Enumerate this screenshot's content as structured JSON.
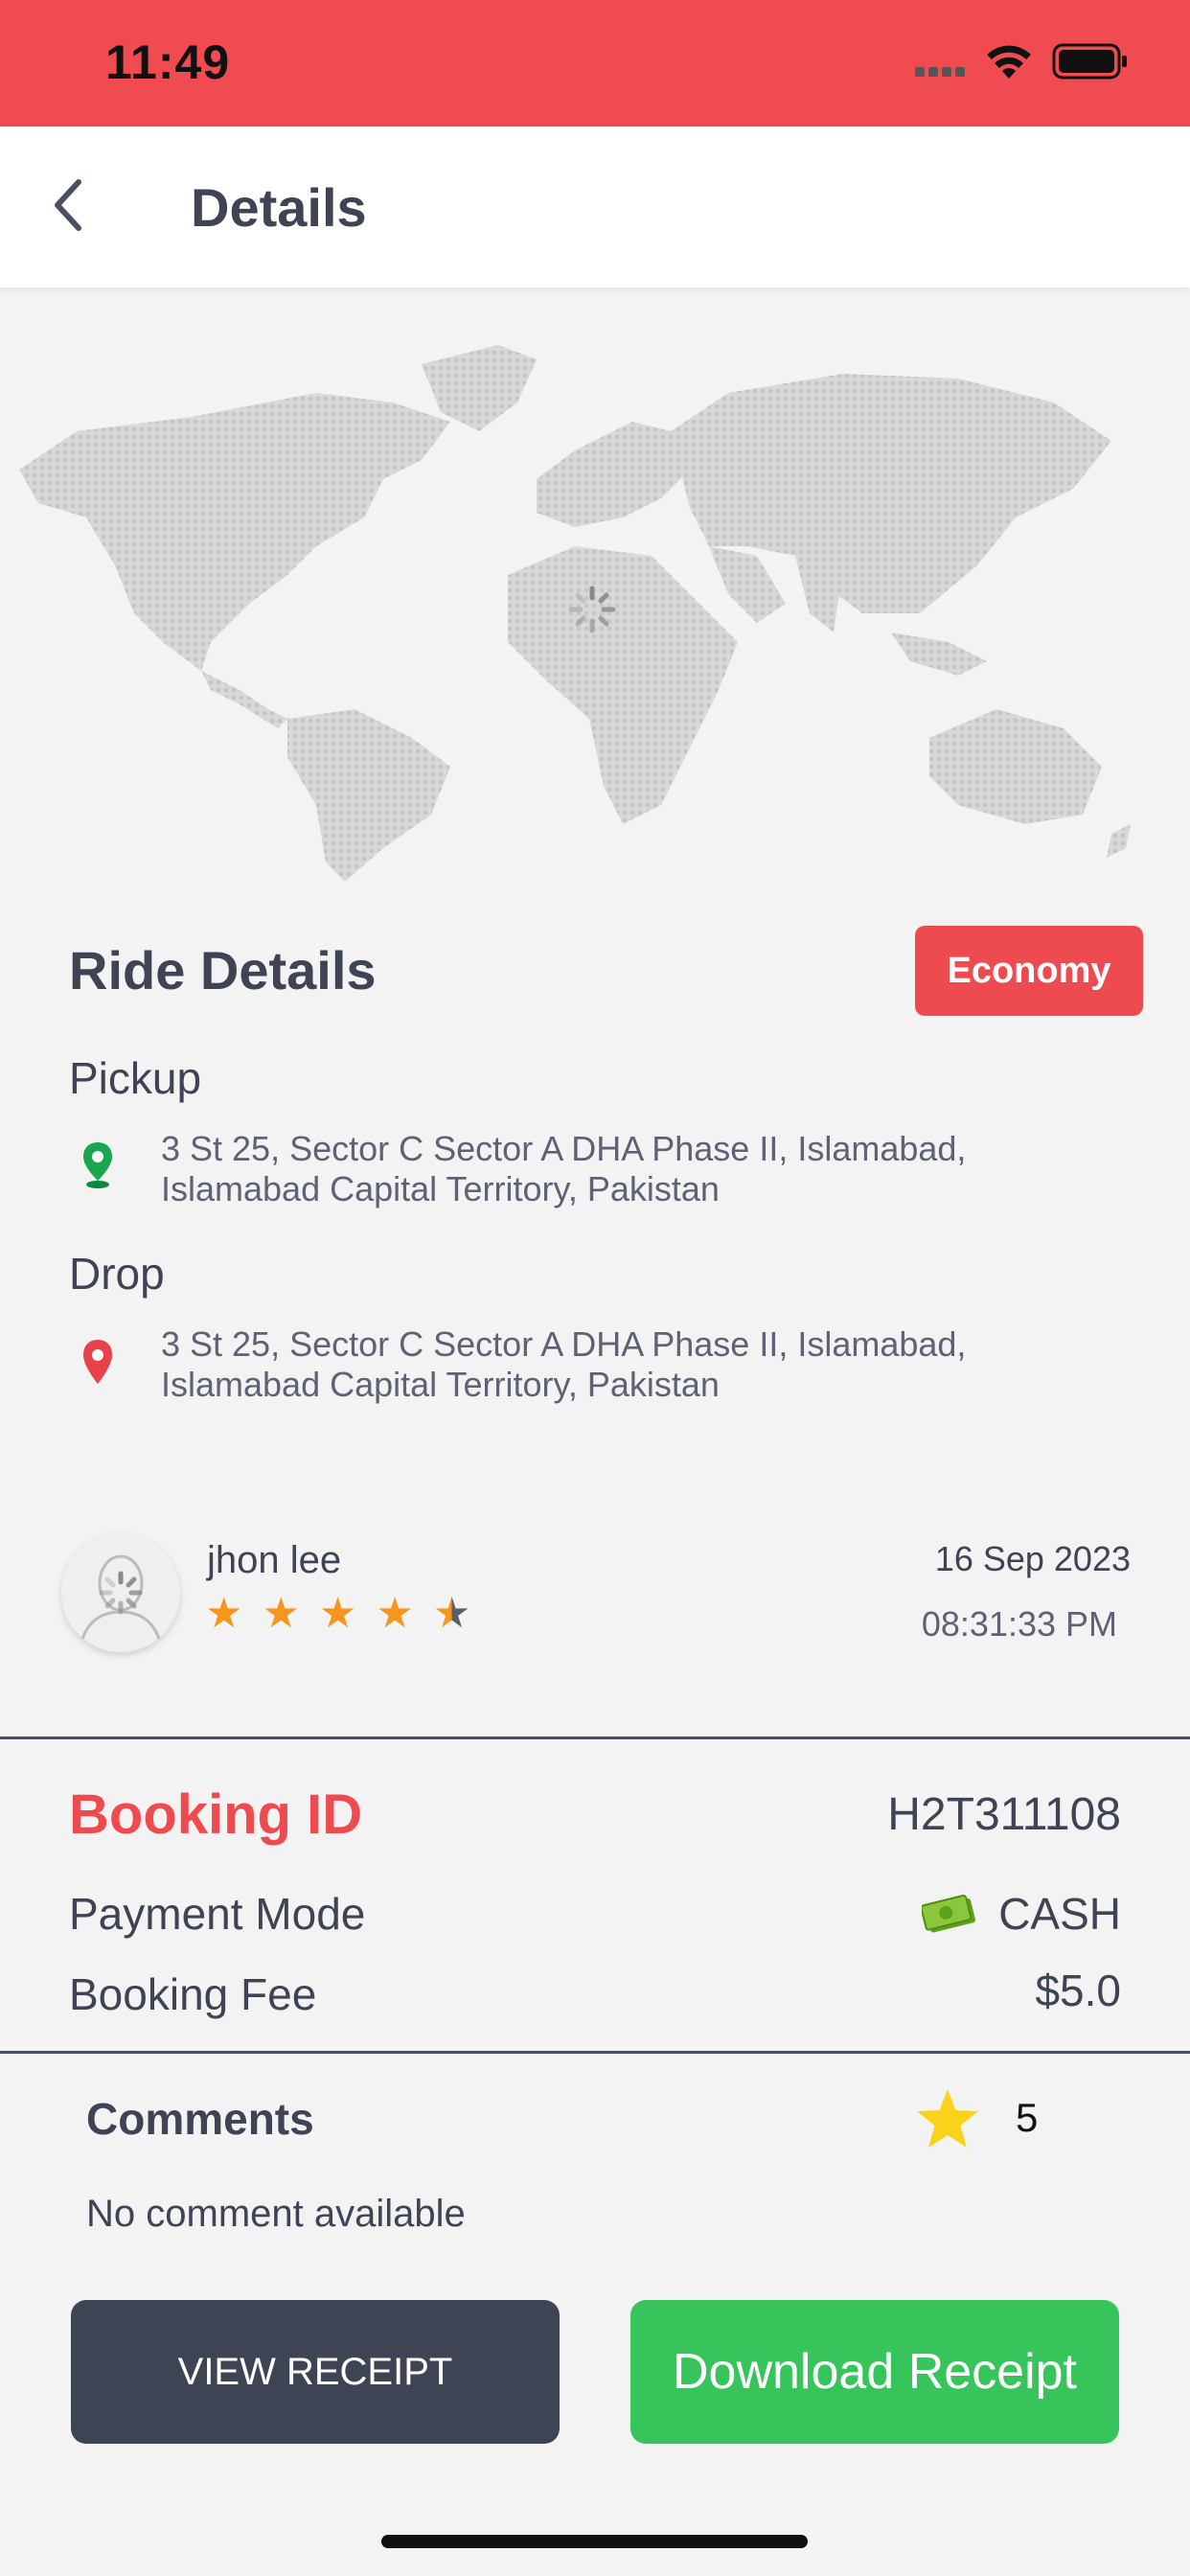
{
  "status_bar": {
    "time": "11:49"
  },
  "header": {
    "title": "Details"
  },
  "ride": {
    "section_title": "Ride Details",
    "category_badge": "Economy",
    "pickup_label": "Pickup",
    "pickup_address_line1": "3 St 25, Sector C Sector A DHA Phase II, Islamabad,",
    "pickup_address_line2": "Islamabad Capital Territory, Pakistan",
    "drop_label": "Drop",
    "drop_address_line1": "3 St 25, Sector C Sector A DHA Phase II, Islamabad,",
    "drop_address_line2": "Islamabad Capital Territory, Pakistan"
  },
  "driver": {
    "name": "jhon lee",
    "rating": 4.5,
    "date": "16 Sep 2023",
    "time": "08:31:33 PM"
  },
  "booking": {
    "id_label": "Booking ID",
    "id_value": "H2T311108",
    "payment_label": "Payment Mode",
    "payment_value": "CASH",
    "fee_label": "Booking Fee",
    "fee_value": "$5.0"
  },
  "comments": {
    "title": "Comments",
    "rating": "5",
    "text": "No comment available"
  },
  "actions": {
    "view_receipt": "VIEW RECEIPT",
    "download_receipt": "Download Receipt"
  },
  "colors": {
    "accent_red": "#ee4b50",
    "green": "#37c45a",
    "dark": "#3f4454",
    "star_orange": "#f7961f",
    "star_yellow": "#f8d31a"
  }
}
